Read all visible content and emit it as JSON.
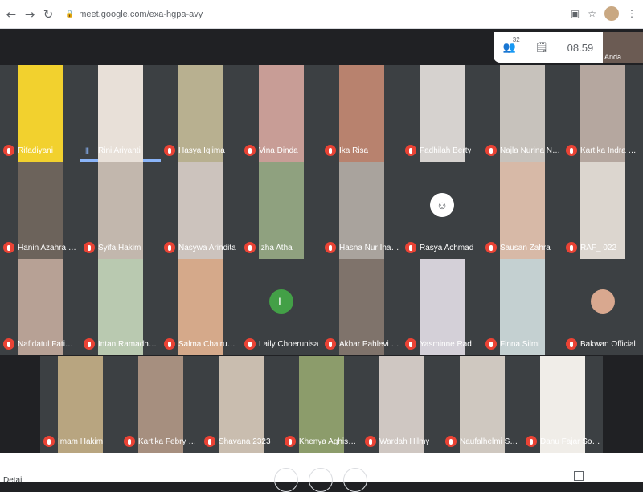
{
  "browser": {
    "url": "meet.google.com/exa-hgpa-avy",
    "back_icon": "back-arrow-icon",
    "forward_icon": "forward-arrow-icon",
    "reload_icon": "reload-icon"
  },
  "meeting": {
    "participants_count": "32",
    "time": "08.59",
    "self_name": "Anda"
  },
  "tiles": [
    {
      "name": "Rifadiyani",
      "mic": "muted",
      "avatar": "",
      "color": "#f2d12e"
    },
    {
      "name": "Rini Ariyanti",
      "mic": "speaking",
      "avatar": "",
      "color": "#e8e0d8"
    },
    {
      "name": "Hasya Iqlima",
      "mic": "muted",
      "avatar": "",
      "color": "#b8b090"
    },
    {
      "name": "Vina Dinda",
      "mic": "muted",
      "avatar": "",
      "color": "#c89d96"
    },
    {
      "name": "Ika Risa",
      "mic": "muted",
      "avatar": "",
      "color": "#b8826e"
    },
    {
      "name": "Fadhilah Berty",
      "mic": "muted",
      "avatar": "",
      "color": "#d6d2cf"
    },
    {
      "name": "Najla Nurina Nari...",
      "mic": "muted",
      "avatar": "",
      "color": "#c7c2bc"
    },
    {
      "name": "Kartika Indra Kira...",
      "mic": "muted",
      "avatar": "",
      "color": "#b5a79f"
    },
    {
      "name": "Hanin Azahra Rus...",
      "mic": "muted",
      "avatar": "",
      "color": "#6c635b"
    },
    {
      "name": "Syifa Hakim",
      "mic": "muted",
      "avatar": "",
      "color": "#c2b7ad"
    },
    {
      "name": "Nasywa Arindita",
      "mic": "muted",
      "avatar": "",
      "color": "#ccc3bd"
    },
    {
      "name": "Izha Atha",
      "mic": "muted",
      "avatar": "",
      "color": "#8fa17f"
    },
    {
      "name": "Hasna Nur Inayah",
      "mic": "muted",
      "avatar": "",
      "color": "#a9a39d"
    },
    {
      "name": "Rasya Achmad",
      "mic": "muted",
      "avatar": "avatar-icon",
      "color": "#3c4043"
    },
    {
      "name": "Sausan Zahra",
      "mic": "muted",
      "avatar": "",
      "color": "#d7b9a7"
    },
    {
      "name": "RAF_ 022",
      "mic": "muted",
      "avatar": "",
      "color": "#dcd6cf"
    },
    {
      "name": "Nafidatul Fatimah",
      "mic": "muted",
      "avatar": "",
      "color": "#b7a195"
    },
    {
      "name": "Intan Ramadhani...",
      "mic": "muted",
      "avatar": "",
      "color": "#b9c9b0"
    },
    {
      "name": "Salma Chairunnisa",
      "mic": "muted",
      "avatar": "",
      "color": "#d5a98a"
    },
    {
      "name": "Laily Choerunisa",
      "mic": "muted",
      "avatar": "L",
      "color": "#3c4043"
    },
    {
      "name": "Akbar Pahlevi Fa...",
      "mic": "muted",
      "avatar": "",
      "color": "#7f736b"
    },
    {
      "name": "Yasminne Rad",
      "mic": "muted",
      "avatar": "",
      "color": "#d4d0d8"
    },
    {
      "name": "Finna Silmi",
      "mic": "muted",
      "avatar": "",
      "color": "#c4d0d1"
    },
    {
      "name": "Bakwan Official",
      "mic": "muted",
      "avatar": "avatar-photo",
      "color": "#3c4043"
    },
    {
      "name": "Imam Hakim",
      "mic": "muted",
      "avatar": "",
      "color": "#b8a580"
    },
    {
      "name": "Kartika Febry Uta...",
      "mic": "muted",
      "avatar": "",
      "color": "#a68f7f"
    },
    {
      "name": "Shavana 2323",
      "mic": "muted",
      "avatar": "",
      "color": "#c9bdaf"
    },
    {
      "name": "Khenya Aghisna ...",
      "mic": "muted",
      "avatar": "",
      "color": "#8c9c6b"
    },
    {
      "name": "Wardah Hilmy",
      "mic": "muted",
      "avatar": "",
      "color": "#cfc7c2"
    },
    {
      "name": "Naufalhelmi Syah...",
      "mic": "muted",
      "avatar": "",
      "color": "#cfc8c0"
    },
    {
      "name": "Danu Fajar Sodiq",
      "mic": "muted",
      "avatar": "",
      "color": "#f0ede8"
    }
  ],
  "bottom": {
    "details_label": "Detail"
  }
}
